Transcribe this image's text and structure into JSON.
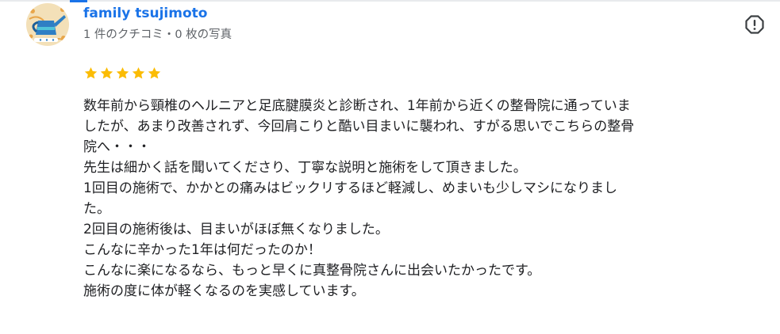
{
  "review": {
    "author": {
      "name": "family tsujimoto",
      "meta": "1 件のクチコミ・0 枚の写真",
      "avatar_icon": "watering-can-avatar"
    },
    "rating": 5,
    "report_icon": "report-icon",
    "lines": [
      "数年前から頸椎のヘルニアと足底腱膜炎と診断され、1年前から近くの整骨院に通っていま",
      "したが、あまり改善されず、今回肩こりと酷い目まいに襲われ、すがる思いでこちらの整骨",
      "院へ・・・",
      "先生は細かく話を聞いてくださり、丁寧な説明と施術をして頂きました。",
      "1回目の施術で、かかとの痛みはビックリするほど軽減し、めまいも少しマシになりまし",
      "た。",
      "2回目の施術後は、目まいがほぼ無くなりました。",
      "こんなに辛かった1年は何だったのか！",
      "こんなに楽になるなら、もっと早くに真整骨院さんに出会いたかったです。",
      "施術の度に体が軽くなるのを実感しています。"
    ]
  },
  "colors": {
    "accent": "#1a73e8",
    "star": "#fbbc04",
    "meta_text": "#5f6368",
    "body_text": "#202124"
  }
}
